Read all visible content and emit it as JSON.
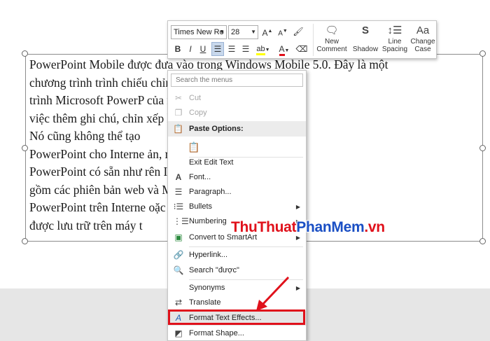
{
  "slide": {
    "lines": [
      "PowerPoint Mobile được đưa vào trong Windows Mobile 5.0. Đây là một",
      "chương trình trình chiếu                    chỉnh sửa các bài thuyết",
      "trình Microsoft PowerP                       của nó bị hạn chế trong",
      "việc thêm ghi chú, chỉn                      xếp lại các trang trình chiếu.",
      "Nó cũng không thể tạo",
      "PowerPoint cho Interne                      ản, miễn phí của Microsoft",
      "PowerPoint có sẵn như                       rên Internet, nó cũng bao",
      "gồm các phiên bản web                      và Microsoft Word.",
      "PowerPoint trên Interne                     oặc chỉnh sửa biểu đồ, video",
      "được lưu trữ trên máy t"
    ]
  },
  "minibar": {
    "font_name": "Times New Ro",
    "font_size": "28",
    "new_comment_label": "New Comment",
    "shadow_label": "Shadow",
    "line_spacing_label": "Line Spacing",
    "change_case_label": "Change Case",
    "bold": "B",
    "italic": "I",
    "underline": "U",
    "font_color_letter": "A",
    "highlight_letter": "ab"
  },
  "menu": {
    "search_placeholder": "Search the menus",
    "cut": "Cut",
    "copy": "Copy",
    "paste_options": "Paste Options:",
    "exit_edit_text": "Exit Edit Text",
    "font": "Font...",
    "paragraph": "Paragraph...",
    "bullets": "Bullets",
    "numbering": "Numbering",
    "convert_smartart": "Convert to SmartArt",
    "hyperlink": "Hyperlink...",
    "search_term": "Search \"được\"",
    "synonyms": "Synonyms",
    "translate": "Translate",
    "format_text_effects": "Format Text Effects...",
    "format_shape": "Format Shape..."
  },
  "watermark": {
    "part1": "ThuThuat",
    "part2": "PhanMem",
    "part3": ".vn"
  },
  "colors": {
    "highlight_box": "#e0111b",
    "watermark_blue": "#1a4fc4",
    "watermark_red": "#e0111b"
  }
}
